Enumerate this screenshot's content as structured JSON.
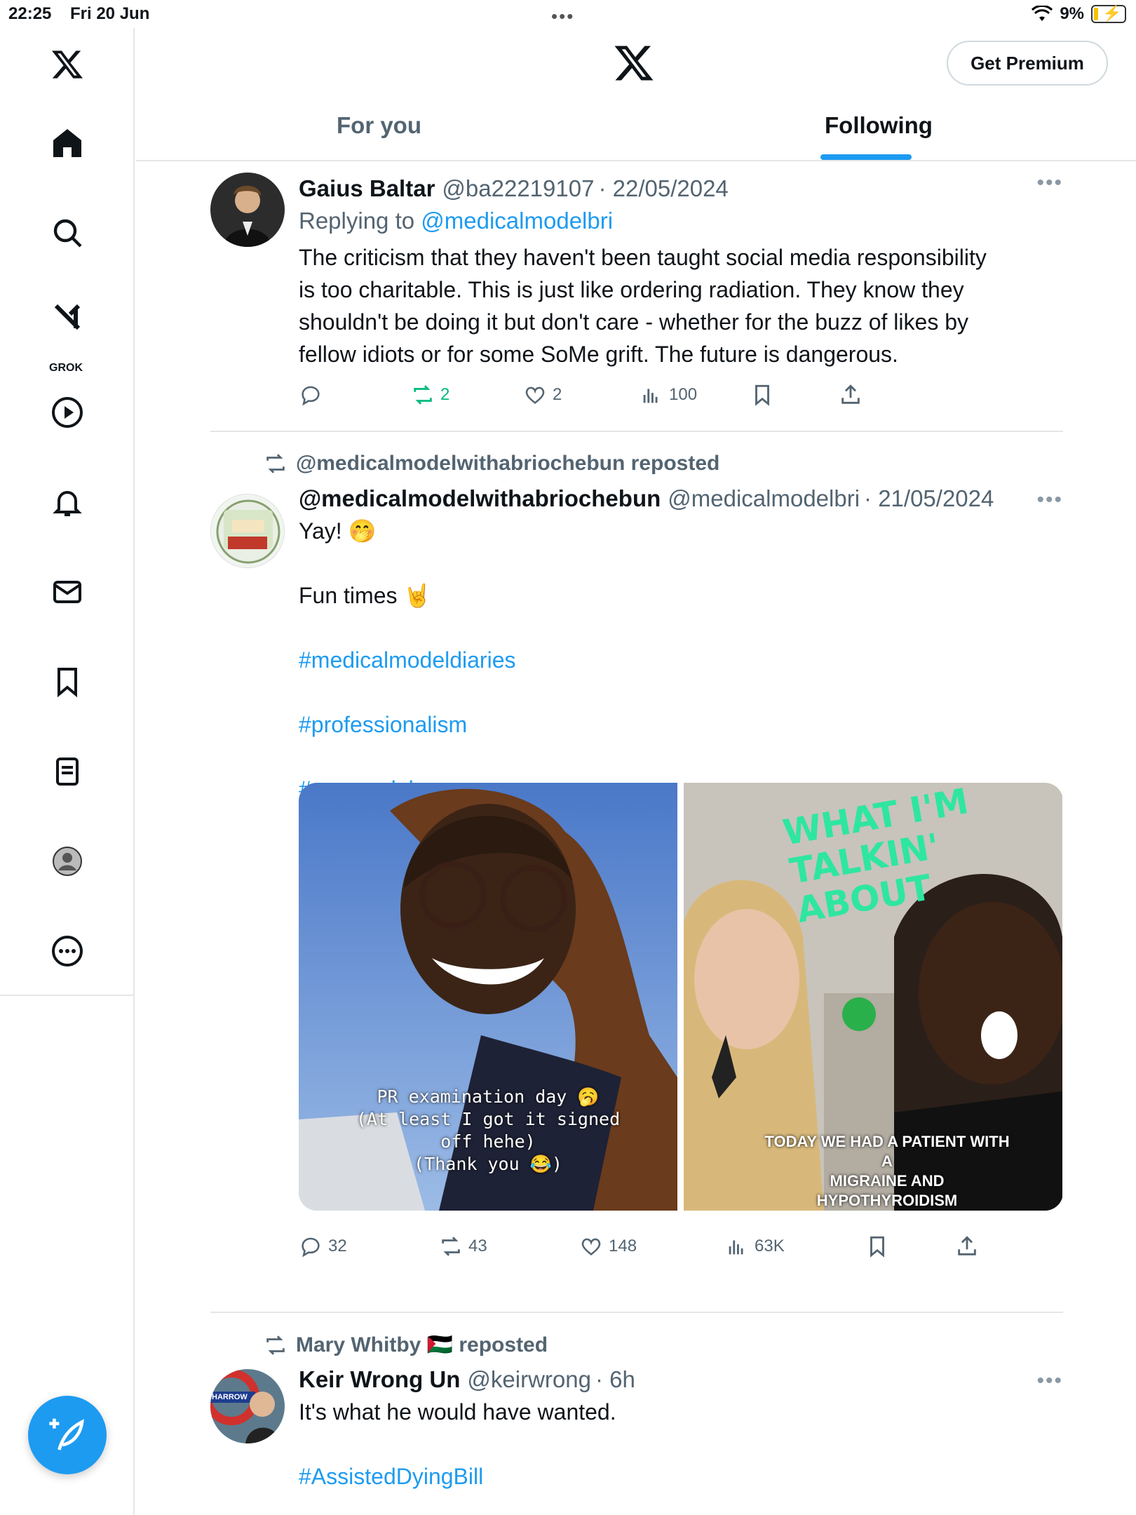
{
  "status": {
    "time": "22:25",
    "date": "Fri 20 Jun",
    "battery": "9%"
  },
  "header": {
    "premium_label": "Get Premium",
    "tabs": [
      "For you",
      "Following"
    ],
    "active_tab": "Following"
  },
  "nav": {
    "grok_label": "GROK"
  },
  "posts": [
    {
      "name": "Gaius Baltar",
      "handle": "@ba22219107",
      "date": "· 22/05/2024",
      "reply_prefix": "Replying to",
      "reply_to": "@medicalmodelbri",
      "body_lines": [
        "The criticism that they haven't been taught social media responsibility",
        "is too charitable. This is just like ordering radiation. They know they",
        "shouldn't be doing it but don't care - whether for the buzz of likes by",
        "fellow idiots or for some SoMe grift. The future is dangerous."
      ],
      "reposts": "2",
      "likes": "2",
      "views": "100"
    },
    {
      "repost_label": "@medicalmodelwithabriochebun reposted",
      "name": "@medicalmodelwithabriochebun",
      "handle": "@medicalmodelbri",
      "date": "· 21/05/2024",
      "line1": "Yay! 🤭",
      "line2": "Fun times 🤘",
      "hashtags": [
        "#medicalmodeldiaries",
        "#professionalism",
        "#pascandal"
      ],
      "media_caption_left": [
        "PR examination day 🥱",
        "(At least I got it signed",
        "off hehe)",
        "(Thank you          😂)"
      ],
      "media_caption_right": [
        "TODAY WE HAD A PATIENT WITH A",
        "MIGRAINE AND HYPOTHYROIDISM"
      ],
      "media_scribble": [
        "WHAT I'M",
        "TALKIN'",
        "ABOUT"
      ],
      "replies": "32",
      "reposts": "43",
      "likes": "148",
      "views": "63K"
    },
    {
      "repost_label": "Mary Whitby 🇵🇸 reposted",
      "name": "Keir Wrong Un",
      "handle": "@keirwrong",
      "date": "· 6h",
      "line1": "It's what he would have wanted.",
      "hashtag": "#AssistedDyingBill",
      "avatar_sign": "HARROW"
    }
  ]
}
